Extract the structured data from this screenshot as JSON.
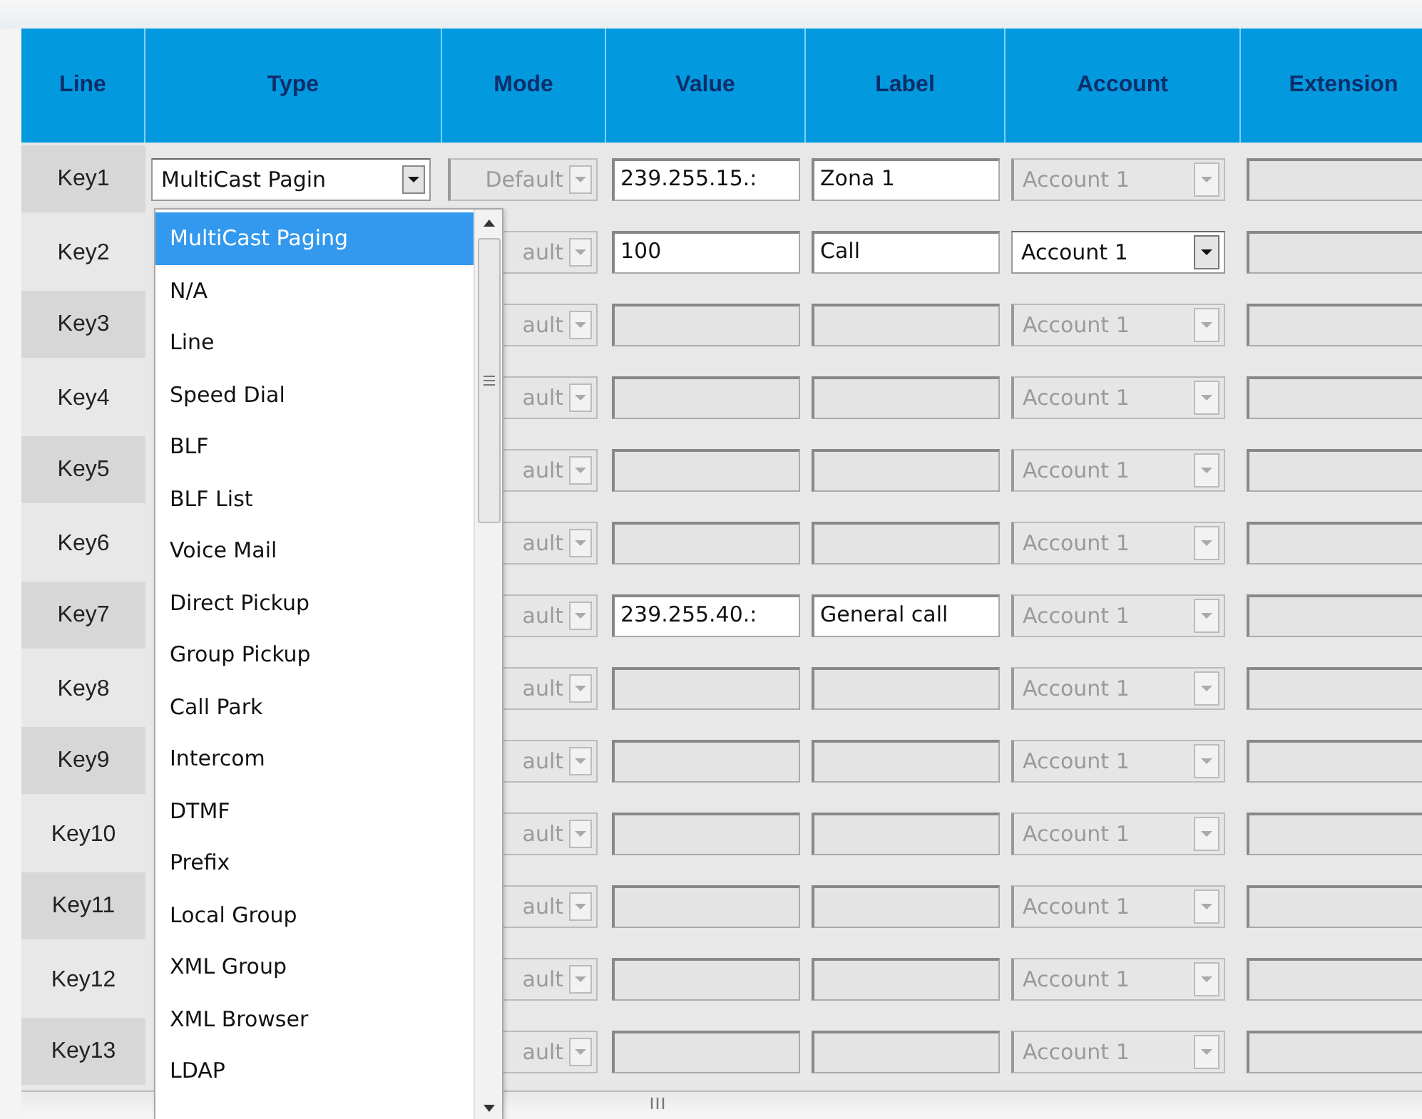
{
  "table": {
    "columns": [
      "Line",
      "Type",
      "Mode",
      "Value",
      "Label",
      "Account",
      "Extension"
    ],
    "rows": [
      {
        "line": "Key1",
        "type": {
          "text": "MultiCast Pagin",
          "disabled": false
        },
        "mode": {
          "text": "Default",
          "disabled": true
        },
        "value": {
          "text": "239.255.15.:",
          "disabled": false
        },
        "label": {
          "text": "Zona 1",
          "disabled": false
        },
        "account": {
          "text": "Account 1",
          "disabled": true
        },
        "extension": {
          "disabled": true
        }
      },
      {
        "line": "Key2",
        "mode": {
          "text": "ault",
          "disabled": true
        },
        "value": {
          "text": "100",
          "disabled": false
        },
        "label": {
          "text": "Call",
          "disabled": false
        },
        "account": {
          "text": "Account 1",
          "disabled": false
        },
        "extension": {
          "disabled": true
        }
      },
      {
        "line": "Key3",
        "mode": {
          "text": "ault",
          "disabled": true
        },
        "value": {
          "disabled": true
        },
        "label": {
          "disabled": true
        },
        "account": {
          "text": "Account 1",
          "disabled": true
        },
        "extension": {
          "disabled": true
        }
      },
      {
        "line": "Key4",
        "mode": {
          "text": "ault",
          "disabled": true
        },
        "value": {
          "disabled": true
        },
        "label": {
          "disabled": true
        },
        "account": {
          "text": "Account 1",
          "disabled": true
        },
        "extension": {
          "disabled": true
        }
      },
      {
        "line": "Key5",
        "mode": {
          "text": "ault",
          "disabled": true
        },
        "value": {
          "disabled": true
        },
        "label": {
          "disabled": true
        },
        "account": {
          "text": "Account 1",
          "disabled": true
        },
        "extension": {
          "disabled": true
        }
      },
      {
        "line": "Key6",
        "mode": {
          "text": "ault",
          "disabled": true
        },
        "value": {
          "disabled": true
        },
        "label": {
          "disabled": true
        },
        "account": {
          "text": "Account 1",
          "disabled": true
        },
        "extension": {
          "disabled": true
        }
      },
      {
        "line": "Key7",
        "mode": {
          "text": "ault",
          "disabled": true
        },
        "value": {
          "text": "239.255.40.:",
          "disabled": false
        },
        "label": {
          "text": "General call",
          "disabled": false
        },
        "account": {
          "text": "Account 1",
          "disabled": true
        },
        "extension": {
          "disabled": true
        }
      },
      {
        "line": "Key8",
        "mode": {
          "text": "ault",
          "disabled": true
        },
        "value": {
          "disabled": true
        },
        "label": {
          "disabled": true
        },
        "account": {
          "text": "Account 1",
          "disabled": true
        },
        "extension": {
          "disabled": true
        }
      },
      {
        "line": "Key9",
        "mode": {
          "text": "ault",
          "disabled": true
        },
        "value": {
          "disabled": true
        },
        "label": {
          "disabled": true
        },
        "account": {
          "text": "Account 1",
          "disabled": true
        },
        "extension": {
          "disabled": true
        }
      },
      {
        "line": "Key10",
        "mode": {
          "text": "ault",
          "disabled": true
        },
        "value": {
          "disabled": true
        },
        "label": {
          "disabled": true
        },
        "account": {
          "text": "Account 1",
          "disabled": true
        },
        "extension": {
          "disabled": true
        }
      },
      {
        "line": "Key11",
        "mode": {
          "text": "ault",
          "disabled": true
        },
        "value": {
          "disabled": true
        },
        "label": {
          "disabled": true
        },
        "account": {
          "text": "Account 1",
          "disabled": true
        },
        "extension": {
          "disabled": true
        }
      },
      {
        "line": "Key12",
        "mode": {
          "text": "ault",
          "disabled": true
        },
        "value": {
          "disabled": true
        },
        "label": {
          "disabled": true
        },
        "account": {
          "text": "Account 1",
          "disabled": true
        },
        "extension": {
          "disabled": true
        }
      },
      {
        "line": "Key13",
        "mode": {
          "text": "ault",
          "disabled": true
        },
        "value": {
          "disabled": true
        },
        "label": {
          "disabled": true
        },
        "account": {
          "text": "Account 1",
          "disabled": true
        },
        "extension": {
          "disabled": true
        }
      }
    ]
  },
  "type_dropdown": {
    "options": [
      {
        "label": "MultiCast Paging",
        "selected": true
      },
      {
        "label": "N/A",
        "selected": false
      },
      {
        "label": "Line",
        "selected": false
      },
      {
        "label": "Speed Dial",
        "selected": false
      },
      {
        "label": "BLF",
        "selected": false
      },
      {
        "label": "BLF List",
        "selected": false
      },
      {
        "label": "Voice Mail",
        "selected": false
      },
      {
        "label": "Direct Pickup",
        "selected": false
      },
      {
        "label": "Group Pickup",
        "selected": false
      },
      {
        "label": "Call Park",
        "selected": false
      },
      {
        "label": "Intercom",
        "selected": false
      },
      {
        "label": "DTMF",
        "selected": false
      },
      {
        "label": "Prefix",
        "selected": false
      },
      {
        "label": "Local Group",
        "selected": false
      },
      {
        "label": "XML Group",
        "selected": false
      },
      {
        "label": "XML Browser",
        "selected": false
      },
      {
        "label": "LDAP",
        "selected": false
      }
    ]
  }
}
